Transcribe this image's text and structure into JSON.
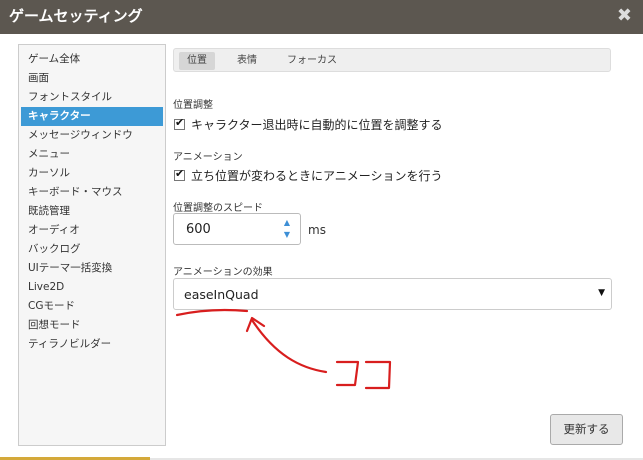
{
  "window": {
    "title": "ゲームセッティング"
  },
  "sidebar": {
    "items": [
      {
        "label": "ゲーム全体"
      },
      {
        "label": "画面"
      },
      {
        "label": "フォントスタイル"
      },
      {
        "label": "キャラクター",
        "active": true
      },
      {
        "label": "メッセージウィンドウ"
      },
      {
        "label": "メニュー"
      },
      {
        "label": "カーソル"
      },
      {
        "label": "キーボード・マウス"
      },
      {
        "label": "既読管理"
      },
      {
        "label": "オーディオ"
      },
      {
        "label": "バックログ"
      },
      {
        "label": "UIテーマ一括変換"
      },
      {
        "label": "Live2D"
      },
      {
        "label": "CGモード"
      },
      {
        "label": "回想モード"
      },
      {
        "label": "ティラノビルダー"
      }
    ]
  },
  "tabs": [
    {
      "label": "位置",
      "active": true
    },
    {
      "label": "表情"
    },
    {
      "label": "フォーカス"
    }
  ],
  "position_section": {
    "label": "位置調整",
    "checkbox_label": "キャラクター退出時に自動的に位置を調整する",
    "checked": true
  },
  "animation_section": {
    "label": "アニメーション",
    "checkbox_label": "立ち位置が変わるときにアニメーションを行う",
    "checked": true
  },
  "speed": {
    "label": "位置調整のスピード",
    "value": "600",
    "unit": "ms"
  },
  "effect": {
    "label": "アニメーションの効果",
    "selected": "easeInQuad"
  },
  "buttons": {
    "update": "更新する"
  },
  "annotation": {
    "text": "ココ",
    "color": "#d81e1e"
  },
  "colors": {
    "titlebar": "#5c5750",
    "accent": "#3d9ad6"
  }
}
